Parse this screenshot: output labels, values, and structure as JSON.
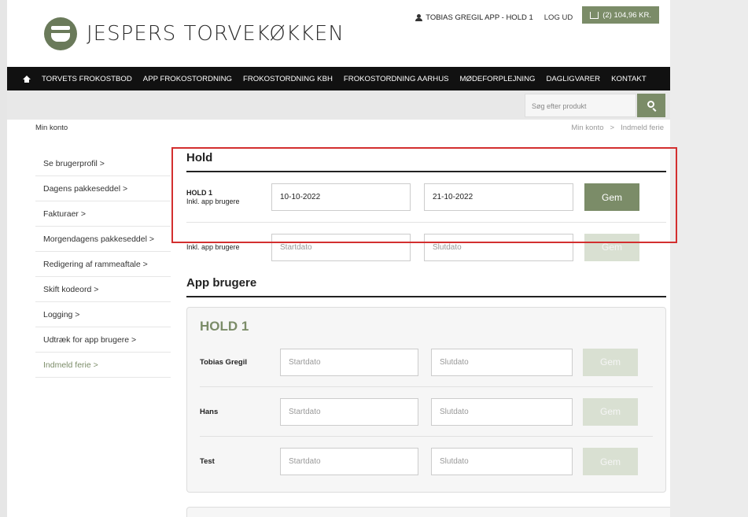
{
  "brand": {
    "name": "JESPERS TORVEKØKKEN",
    "accent": "#7b8c68",
    "highlight": "#d32f2f"
  },
  "topbar": {
    "user": "TOBIAS GREGIL APP - HOLD 1",
    "logout": "LOG UD",
    "cart": "(2) 104,96 KR."
  },
  "nav": [
    "TORVETS FROKOSTBOD",
    "APP FROKOSTORDNING",
    "FROKOSTORDNING KBH",
    "FROKOSTORDNING AARHUS",
    "MØDEFORPLEJNING",
    "DAGLIGVARER",
    "KONTAKT"
  ],
  "search": {
    "placeholder": "Søg efter produkt"
  },
  "breadcrumb": {
    "left": "Min konto",
    "items": [
      "Min konto",
      ">",
      "Indmeld ferie"
    ]
  },
  "sidebar": [
    "Se brugerprofil >",
    "Dagens pakkeseddel >",
    "Fakturaer >",
    "Morgendagens pakkeseddel >",
    "Redigering af rammeaftale >",
    "Skift kodeord >",
    "Logging >",
    "Udtræk for app brugere >",
    "Indmeld ferie >"
  ],
  "hold_section": {
    "title": "Hold",
    "rows": [
      {
        "name": "HOLD 1",
        "sub": "Inkl. app brugere",
        "start": "10-10-2022",
        "end": "21-10-2022",
        "button": "Gem"
      },
      {
        "name": "",
        "sub": "Inkl. app brugere",
        "start_placeholder": "Startdato",
        "end_placeholder": "Slutdato",
        "button": "Gem"
      }
    ]
  },
  "app_section": {
    "title": "App brugere",
    "group": "HOLD 1",
    "users": [
      {
        "name": "Tobias Gregil",
        "start_placeholder": "Startdato",
        "end_placeholder": "Slutdato",
        "button": "Gem"
      },
      {
        "name": "Hans",
        "start_placeholder": "Startdato",
        "end_placeholder": "Slutdato",
        "button": "Gem"
      },
      {
        "name": "Test",
        "start_placeholder": "Startdato",
        "end_placeholder": "Slutdato",
        "button": "Gem"
      }
    ]
  }
}
